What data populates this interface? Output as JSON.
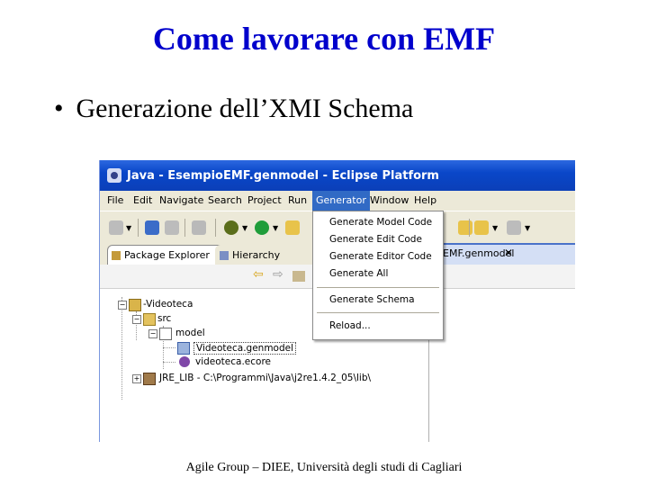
{
  "slide": {
    "title": "Come lavorare con EMF",
    "bullet": "Generazione dell’XMI Schema",
    "footer": "Agile Group – DIEE, Università degli studi di Cagliari"
  },
  "window": {
    "title": "Java - EsempioEMF.genmodel - Eclipse Platform"
  },
  "menubar": [
    "File",
    "Edit",
    "Navigate",
    "Search",
    "Project",
    "Run",
    "Generator",
    "Window",
    "Help"
  ],
  "generator_menu": {
    "items": [
      "Generate Model Code",
      "Generate Edit Code",
      "Generate Editor Code",
      "Generate All",
      "Generate Schema",
      "Reload..."
    ]
  },
  "view_tabs": {
    "package_explorer": "Package Explorer",
    "close_glyph": "✕",
    "hierarchy": "Hierarchy"
  },
  "editor_tab": {
    "label": "EMF.genmodel",
    "close_glyph": "✕"
  },
  "tree": {
    "project": "-Videoteca",
    "src": "src",
    "model": "model",
    "genmodel_file": "Videoteca.genmodel",
    "ecore_file": "videoteca.ecore",
    "jre_lib": "JRE_LIB - C:\\Programmi\\Java\\j2re1.4.2_05\\lib\\",
    "toggles": {
      "expanded": "−",
      "collapsed": "+"
    }
  },
  "icons": {
    "arrow_left": "⇦",
    "arrow_right": "⇨",
    "dropdown": "▼"
  },
  "colors": {
    "title_blue": "#0000cc",
    "titlebar": "#0a47c9",
    "menu_highlight": "#316ac5"
  }
}
